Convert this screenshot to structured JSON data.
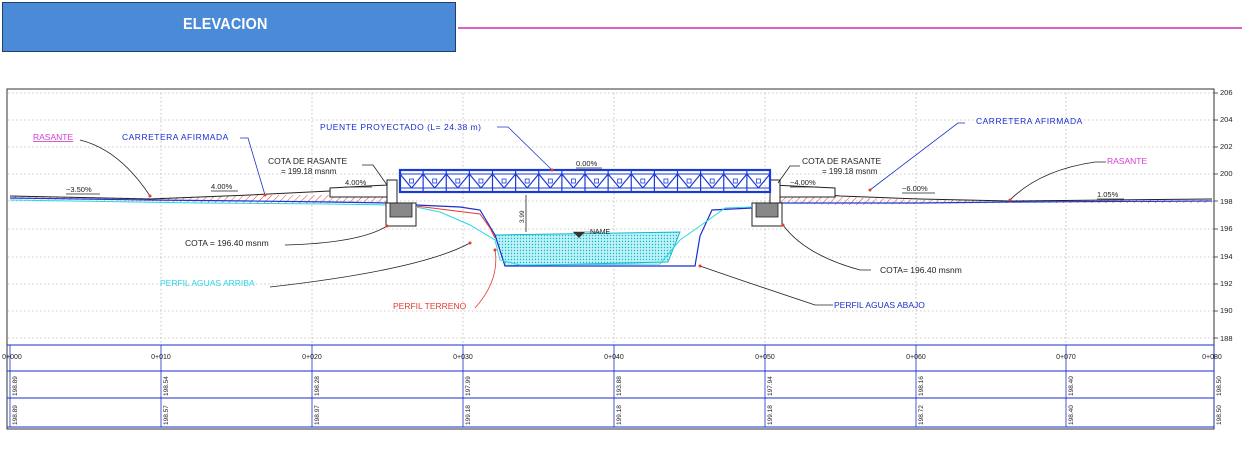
{
  "header": {
    "title": "ELEVACION"
  },
  "elevation_scale": [
    "206",
    "204",
    "202",
    "200",
    "198",
    "196",
    "194",
    "192",
    "190",
    "188"
  ],
  "labels": {
    "rasante_left": "RASANTE",
    "rasante_right": "RASANTE",
    "carretera_left": "CARRETERA AFIRMADA",
    "carretera_right": "CARRETERA AFIRMADA",
    "puente": "PUENTE PROYECTADO (L= 24.38 m)",
    "cota_rasante_left_1": "COTA DE RASANTE",
    "cota_rasante_left_2": "= 199.18 msnm",
    "cota_rasante_right_1": "COTA DE RASANTE",
    "cota_rasante_right_2": "= 199.18 msnm",
    "cota_left": "COTA = 196.40 msnm",
    "cota_right": "COTA= 196.40 msnm",
    "perfil_arriba": "PERFIL AGUAS ARRIBA",
    "perfil_terreno": "PERFIL TERRENO",
    "perfil_abajo": "PERFIL AGUAS ABAJO",
    "name": "NAME",
    "gap": "3.99"
  },
  "slopes": {
    "s1": "−3.50%",
    "s2": "4.00%",
    "s3": "4.00%",
    "s4": "0.00%",
    "s5": "−4.00%",
    "s6": "−6.00%",
    "s7": "1.05%"
  },
  "stations": [
    "0+000",
    "0+010",
    "0+020",
    "0+030",
    "0+040",
    "0+050",
    "0+060",
    "0+070",
    "0+080"
  ],
  "row_terreno": [
    "198.89",
    "198.54",
    "198.28",
    "197.99",
    "193.88",
    "197.94",
    "198.16",
    "198.40",
    "198.50"
  ],
  "row_rasante": [
    "198.89",
    "198.57",
    "198.97",
    "199.18",
    "199.18",
    "199.18",
    "198.72",
    "198.40",
    "198.50"
  ],
  "colors": {
    "title_fill": "#4b8ad6",
    "title_line": "#d964c8",
    "bridge": "#1a3ad6",
    "water": "#2ad6e6",
    "terrain": "#e63b2e",
    "road_label": "#1a2ecc",
    "rasante_label": "#d43ed1"
  }
}
